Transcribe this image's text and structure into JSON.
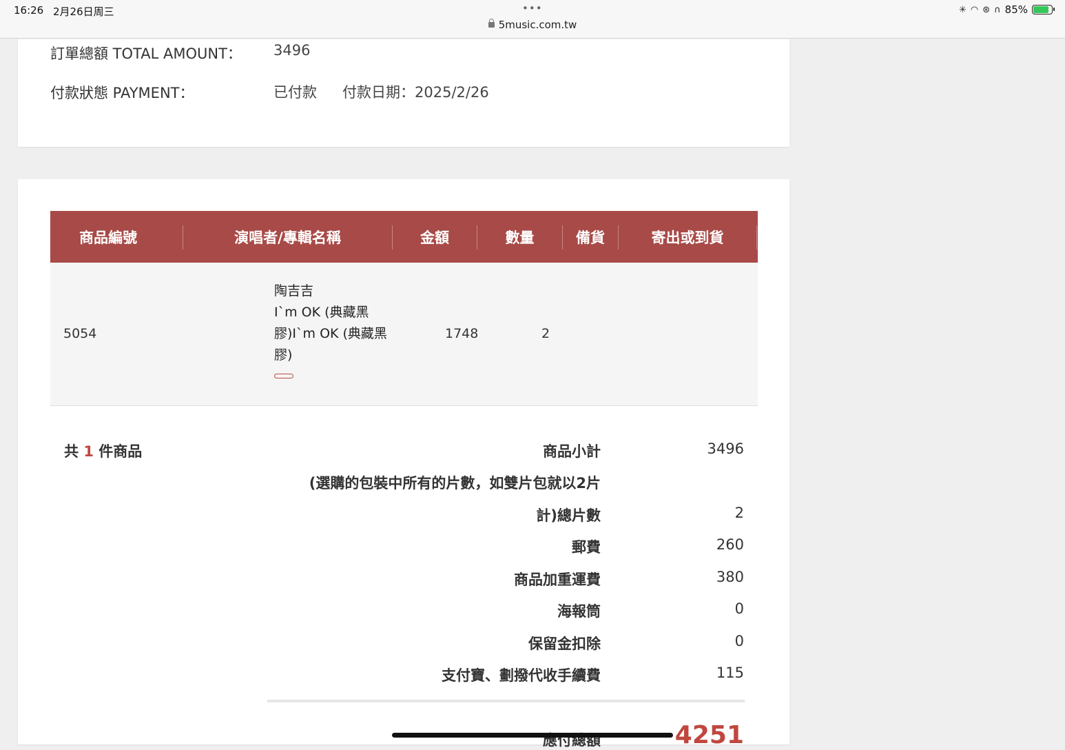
{
  "status_bar": {
    "time": "16:26",
    "date": "2月26日周三",
    "url": "5music.com.tw",
    "battery": "85%",
    "battery_level": 0.85
  },
  "summary": {
    "total_label": "訂單總額 TOTAL AMOUNT：",
    "total_value": "3496",
    "payment_label": "付款狀態 PAYMENT：",
    "payment_status": "已付款",
    "payment_date": "付款日期：2025/2/26"
  },
  "table": {
    "headers": [
      "商品編號",
      "演唱者/專輯名稱",
      "金額",
      "數量",
      "備貨",
      "寄出或到貨"
    ],
    "rows": [
      {
        "product_id": "5054",
        "artist": "陶吉吉",
        "album_line1": "I`m OK (典藏黑",
        "album_line2": "膠)I`m OK (典藏黑",
        "album_line3": "膠)",
        "amount": "1748",
        "quantity": "2",
        "stock": "",
        "shipping": ""
      }
    ]
  },
  "totals": {
    "count_prefix": "共",
    "count_num": "1",
    "count_suffix": "件商品",
    "rows": [
      {
        "label": "商品小計",
        "value": "3496"
      },
      {
        "label": "(選購的包裝中所有的片數，如雙片包就以2片",
        "value": ""
      },
      {
        "label": "計)總片數",
        "value": "2"
      },
      {
        "label": "郵費",
        "value": "260"
      },
      {
        "label": "商品加重運費",
        "value": "380"
      },
      {
        "label": "海報筒",
        "value": "0"
      },
      {
        "label": "保留金扣除",
        "value": "0"
      },
      {
        "label": "支付寶、劃撥代收手續費",
        "value": "115"
      }
    ],
    "grand_label": "應付總額",
    "grand_value": "4251"
  },
  "colors": {
    "header_bg": "#a84a47",
    "accent": "#c0473f",
    "battery": "#35c759"
  }
}
